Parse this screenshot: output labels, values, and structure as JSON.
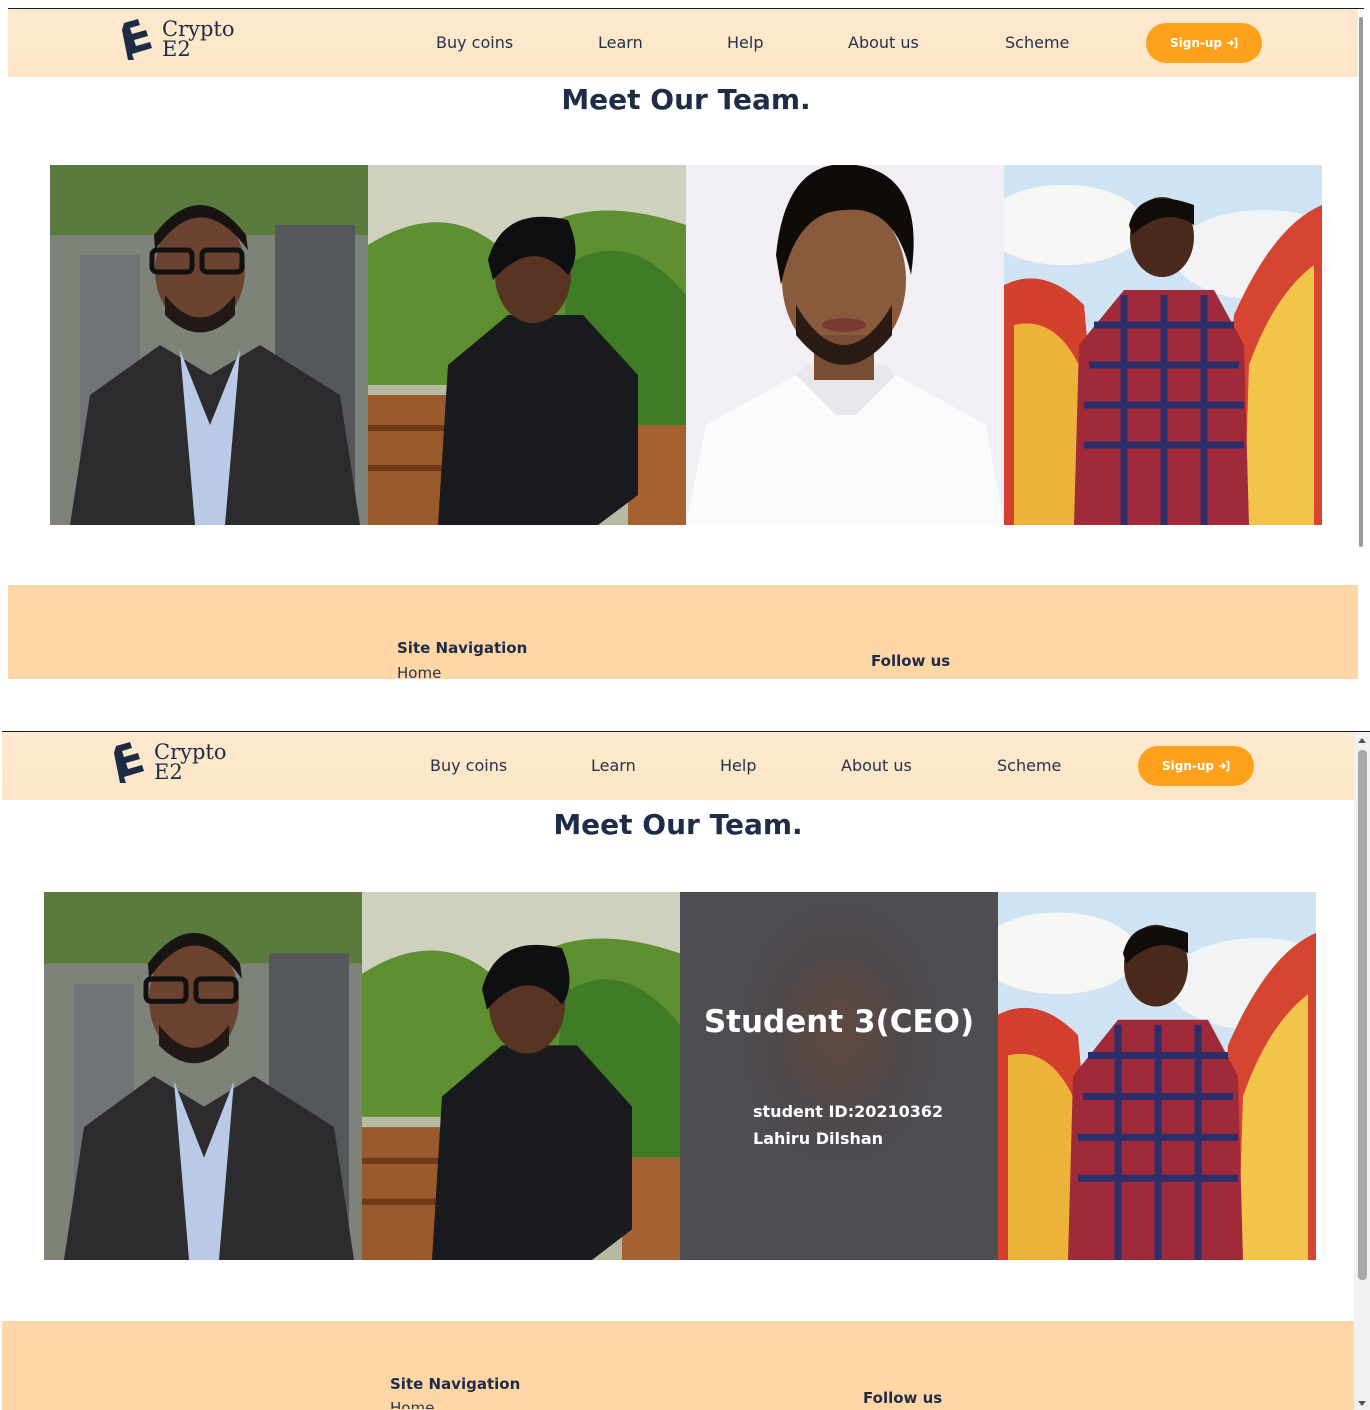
{
  "brand": {
    "line1": "Crypto",
    "line2": "E2"
  },
  "nav": {
    "links": [
      "Buy coins",
      "Learn",
      "Help",
      "About us",
      "Scheme"
    ],
    "signup_label": "Sign-up",
    "signup_icon": "sign-in-icon"
  },
  "team": {
    "title": "Meet Our Team.",
    "members": [
      {
        "photo": "member-1-photo"
      },
      {
        "photo": "member-2-photo"
      },
      {
        "photo": "member-3-photo",
        "overlay_title": "Student 3(CEO)",
        "overlay_id": "student ID:20210362",
        "overlay_name": "Lahiru Dilshan"
      },
      {
        "photo": "member-4-photo"
      }
    ]
  },
  "footer": {
    "site_nav_heading": "Site Navigation",
    "site_nav_first": "Home",
    "follow_heading": "Follow us"
  },
  "colors": {
    "nav_bg": "#fde9cf",
    "accent": "#ffa11c",
    "footer_bg": "#ffd6a5",
    "text_dark": "#1f2c47"
  }
}
